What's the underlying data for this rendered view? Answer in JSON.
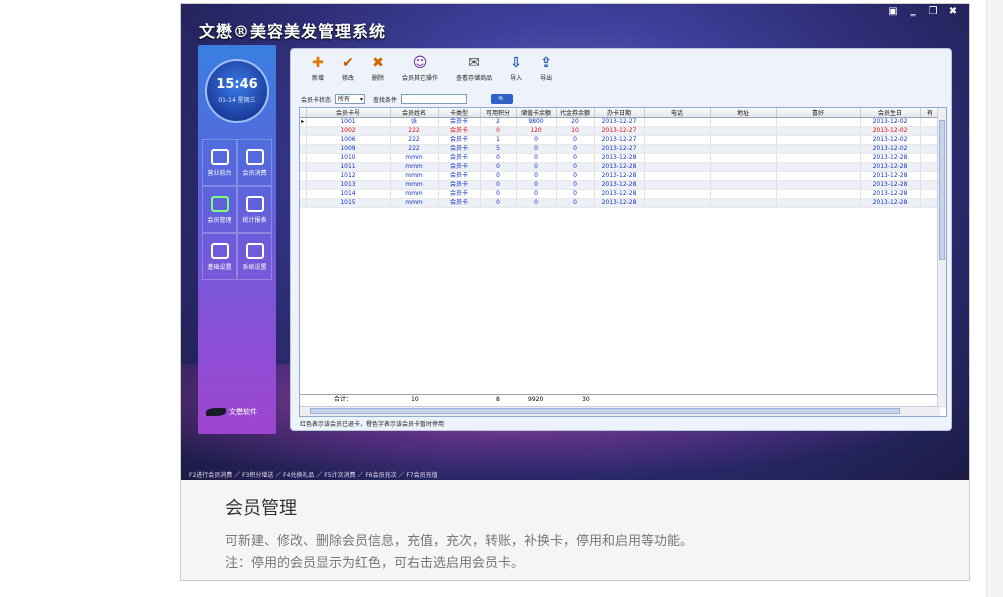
{
  "app": {
    "title": "文懋®美容美发管理系统",
    "window_controls": [
      "▣",
      "‗",
      "❐",
      "✖"
    ]
  },
  "clock": {
    "time": "15:46",
    "date": "01-14 星期三"
  },
  "sidebar": {
    "items": [
      {
        "label": "营业前台",
        "icon": "monitor-icon"
      },
      {
        "label": "会员消费",
        "icon": "briefcase-icon"
      },
      {
        "label": "会员管理",
        "icon": "member-icon"
      },
      {
        "label": "统计报表",
        "icon": "chart-icon"
      },
      {
        "label": "基础设置",
        "icon": "gear-icon"
      },
      {
        "label": "系统设置",
        "icon": "wrench-icon"
      }
    ],
    "brand": "文懋软件"
  },
  "toolbar": {
    "buttons": [
      {
        "label": "新增",
        "glyph": "✚",
        "color": "#e07b00"
      },
      {
        "label": "修改",
        "glyph": "✔",
        "color": "#c05a00"
      },
      {
        "label": "删除",
        "glyph": "✖",
        "color": "#d06a00"
      },
      {
        "label": "会员其它操作",
        "glyph": "☺",
        "color": "#6a2a9a"
      },
      {
        "label": "查看存储商品",
        "glyph": "✉",
        "color": "#444"
      },
      {
        "label": "导入",
        "glyph": "⇩",
        "color": "#1a4fb0"
      },
      {
        "label": "导出",
        "glyph": "⇪",
        "color": "#1a4fb0"
      }
    ]
  },
  "filter": {
    "status_label": "会员卡状态",
    "status_value": "所有",
    "search_label": "查找条件",
    "search_value": "",
    "search_button": "🔍"
  },
  "table": {
    "columns": [
      "会员卡号",
      "会员姓名",
      "卡类型",
      "可用积分",
      "储值卡余额",
      "代金券余额",
      "办卡日期",
      "电话",
      "地址",
      "喜好",
      "会员生日",
      "有"
    ],
    "rows": [
      {
        "cells": [
          "1001",
          "张",
          "会员卡",
          "2",
          "9800",
          "20",
          "2013-12-27",
          "",
          "",
          "",
          "2013-12-02",
          ""
        ],
        "status": "blue"
      },
      {
        "cells": [
          "1002",
          "222",
          "会员卡",
          "0",
          "120",
          "10",
          "2013-12-27",
          "",
          "",
          "",
          "2013-12-02",
          ""
        ],
        "status": "red"
      },
      {
        "cells": [
          "1006",
          "222",
          "会员卡",
          "1",
          "0",
          "0",
          "2013-12-27",
          "",
          "",
          "",
          "2013-12-02",
          ""
        ],
        "status": "blue"
      },
      {
        "cells": [
          "1009",
          "222",
          "会员卡",
          "5",
          "0",
          "0",
          "2013-12-27",
          "",
          "",
          "",
          "2013-12-02",
          ""
        ],
        "status": "blue"
      },
      {
        "cells": [
          "1010",
          "mmm",
          "会员卡",
          "0",
          "0",
          "0",
          "2013-12-28",
          "",
          "",
          "",
          "2013-12-28",
          ""
        ],
        "status": "blue"
      },
      {
        "cells": [
          "1011",
          "mmm",
          "会员卡",
          "0",
          "0",
          "0",
          "2013-12-28",
          "",
          "",
          "",
          "2013-12-28",
          ""
        ],
        "status": "blue"
      },
      {
        "cells": [
          "1012",
          "mmm",
          "会员卡",
          "0",
          "0",
          "0",
          "2013-12-28",
          "",
          "",
          "",
          "2013-12-28",
          ""
        ],
        "status": "blue"
      },
      {
        "cells": [
          "1013",
          "mmm",
          "会员卡",
          "0",
          "0",
          "0",
          "2013-12-28",
          "",
          "",
          "",
          "2013-12-28",
          ""
        ],
        "status": "blue"
      },
      {
        "cells": [
          "1014",
          "mmm",
          "会员卡",
          "0",
          "0",
          "0",
          "2013-12-28",
          "",
          "",
          "",
          "2013-12-28",
          ""
        ],
        "status": "blue"
      },
      {
        "cells": [
          "1015",
          "mmm",
          "会员卡",
          "0",
          "0",
          "0",
          "2013-12-28",
          "",
          "",
          "",
          "2013-12-28",
          ""
        ],
        "status": "blue"
      }
    ],
    "total": {
      "label": "合计：",
      "count": "10",
      "points": "8",
      "balance": "9920",
      "voucher": "30"
    }
  },
  "status_bar": "红色表示该会员已退卡，橙色字表示该会员卡暂时停用",
  "hotkeys": "F2进行会员消费 ／ F3积分增送 ／ F4兑换礼品 ／ F5计次消费 ／ F6会员充次 ／ F7会员充值",
  "caption": {
    "title": "会员管理",
    "line1": "可新建、修改、删除会员信息，充值，充次，转账，补换卡，停用和启用等功能。",
    "line2": "注：停用的会员显示为红色，可右击选启用会员卡。"
  },
  "colors": {
    "blue_text": "#1233c4",
    "red_text": "#e01010",
    "accent": "#2d62c8"
  }
}
